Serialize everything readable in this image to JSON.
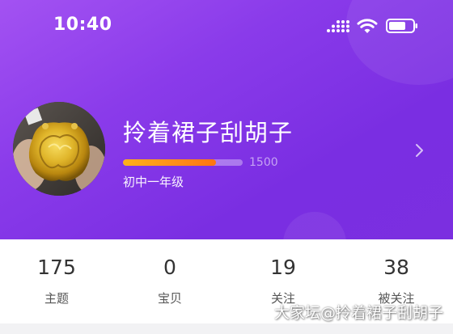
{
  "status_bar": {
    "time": "10:40",
    "signal_icon": "signal-bars-icon",
    "wifi_icon": "wifi-icon",
    "battery_icon": "battery-icon"
  },
  "profile": {
    "avatar_icon": "gold-lock-pendant-photo",
    "username": "拎着裙子刮胡子",
    "progress_value": "1500",
    "progress_fraction": 0.78,
    "level": "初中一年级",
    "chevron_icon": "chevron-right-icon"
  },
  "stats": [
    {
      "value": "175",
      "label": "主题"
    },
    {
      "value": "0",
      "label": "宝贝"
    },
    {
      "value": "19",
      "label": "关注"
    },
    {
      "value": "38",
      "label": "被关注"
    }
  ],
  "watermark": "大家坛@拎着裙子刮胡子",
  "colors": {
    "header_gradient_start": "#a352f2",
    "header_gradient_end": "#7b2fe0",
    "progress_orange": "#ff8c1a"
  }
}
